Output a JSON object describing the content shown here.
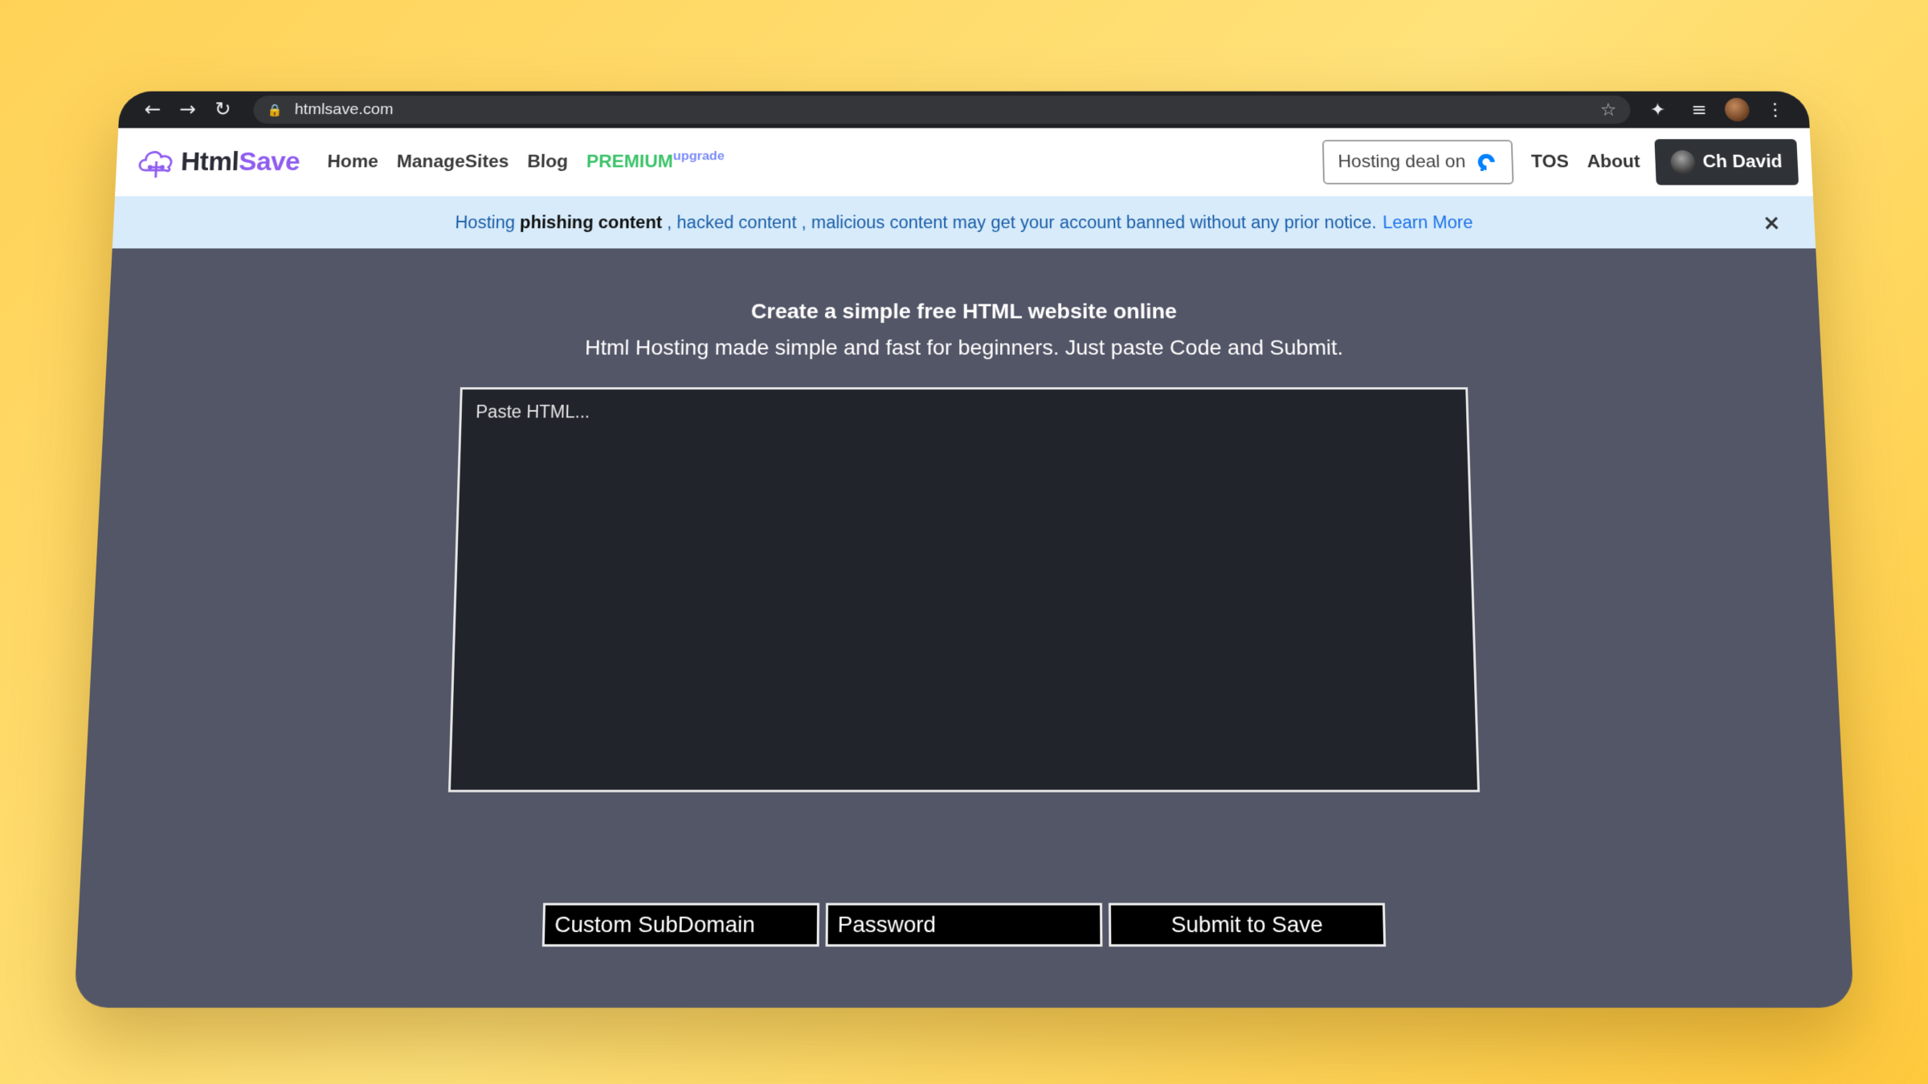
{
  "browser": {
    "url": "htmlsave.com"
  },
  "navbar": {
    "logo_html": "Html",
    "logo_save": "Save",
    "links": [
      "Home",
      "ManageSites",
      "Blog"
    ],
    "premium": "PREMIUM",
    "upgrade": "upgrade",
    "hosting_deal": "Hosting deal on",
    "tos": "TOS",
    "about": "About",
    "user": "Ch David"
  },
  "alert": {
    "prefix": "Hosting",
    "bold": "phishing content",
    "rest": ", hacked content , malicious content may get your account banned without any prior notice.",
    "learn_more": "Learn More",
    "close": "×"
  },
  "main": {
    "headline": "Create a simple free HTML website online",
    "subline": "Html Hosting made simple and fast for beginners. Just paste Code and Submit.",
    "editor_placeholder": "Paste HTML...",
    "subdomain_placeholder": "Custom SubDomain",
    "password_placeholder": "Password",
    "submit_label": "Submit to Save"
  },
  "colors": {
    "background": "#535667",
    "accent_purple": "#8f5cf0",
    "premium_green": "#3cc46a",
    "alert_bg": "#d7ebfb",
    "alert_link": "#1b72e8"
  }
}
